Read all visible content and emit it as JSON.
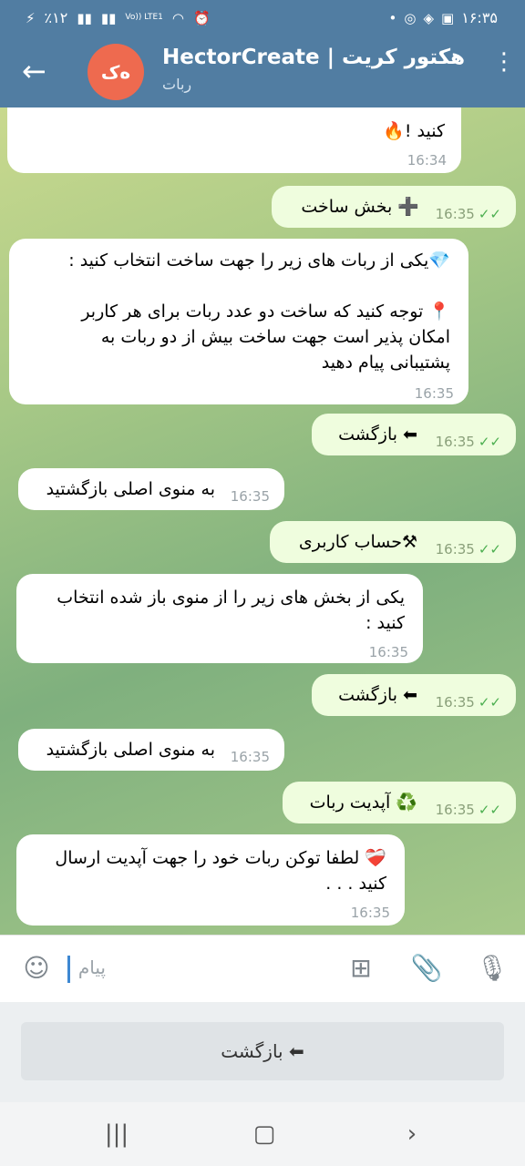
{
  "status_bar": {
    "time": "۱۶:۳۵",
    "battery": "٪۱۲",
    "network": "Vo)) LTE1"
  },
  "header": {
    "avatar_initials": "ه‌ک",
    "title": "HectorCreate | هکتور کریت",
    "subtitle": "ربات"
  },
  "messages": [
    {
      "text": "کنید !🔥",
      "time": "16:34",
      "dir": "in"
    },
    {
      "text": "➕ بخش ساخت",
      "time": "16:35",
      "dir": "out"
    },
    {
      "line1": "💎یکی از ربات های زیر را جهت ساخت انتخاب کنید :",
      "line2": "📍 توجه کنید که ساخت دو عدد ربات برای هر کاربر",
      "line3": "امکان پذیر است جهت ساخت بیش از دو ربات به",
      "line4": "پشتیبانی پیام دهید",
      "time": "16:35",
      "dir": "in"
    },
    {
      "text": "⬅ بازگشت",
      "time": "16:35",
      "dir": "out"
    },
    {
      "text": "به منوی اصلی بازگشتید",
      "time": "16:35",
      "dir": "in"
    },
    {
      "text": "⚒حساب کاربری",
      "time": "16:35",
      "dir": "out"
    },
    {
      "line1": "یکی از بخش های زیر را از منوی باز شده انتخاب",
      "line2": "کنید :",
      "time": "16:35",
      "dir": "in"
    },
    {
      "text": "⬅ بازگشت",
      "time": "16:35",
      "dir": "out"
    },
    {
      "text": "به منوی اصلی بازگشتید",
      "time": "16:35",
      "dir": "in"
    },
    {
      "text": "♻️ آپدیت ربات",
      "time": "16:35",
      "dir": "out"
    },
    {
      "line1": "❤️‍🩹 لطفا توکن ربات خود را جهت آپدیت ارسال",
      "line2": "کنید . . .",
      "time": "16:35",
      "dir": "in"
    }
  ],
  "input": {
    "placeholder": "پیام"
  },
  "keyboard": {
    "button_label": "⬅ بازگشت"
  },
  "colors": {
    "header": "#517da2",
    "outgoing": "#effdde",
    "incoming": "#ffffff",
    "avatar": "#ee6a4f"
  }
}
